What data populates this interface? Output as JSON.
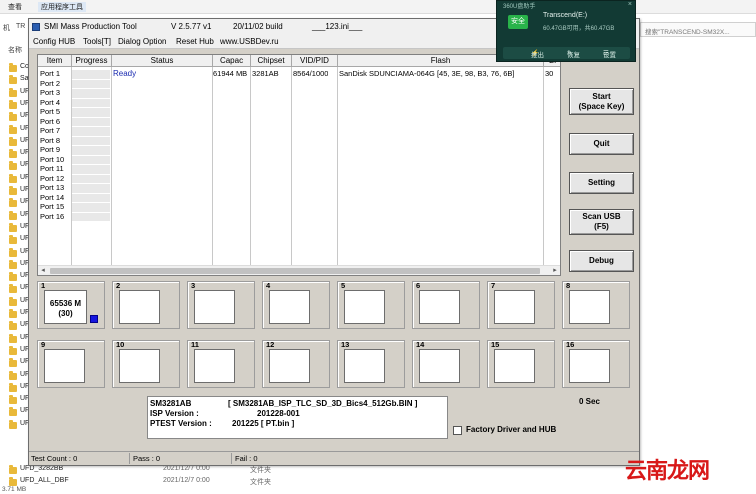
{
  "explorer": {
    "menu_view": "查看",
    "menu_app_tools": "应用程序工具",
    "addr_prefix": "机",
    "addr_tr": "TR",
    "search_placeholder": "搜索\"TRANSCEND-SM32X...",
    "col_name": "名称",
    "left_items": [
      "Co",
      "Sa",
      "UF",
      "UF",
      "UF",
      "UF",
      "UF",
      "UF",
      "UF",
      "UF",
      "UF",
      "UF",
      "UF",
      "UF",
      "UF",
      "UF",
      "UF",
      "UF",
      "UF",
      "UF",
      "UF",
      "UF",
      "UF",
      "UF",
      "UF",
      "UF",
      "UF",
      "UF",
      "UF",
      "UF"
    ],
    "bottom_rows": [
      {
        "name": "UFD_3282BB",
        "date": "2021/12/7 0:00",
        "type": "文件夹"
      },
      {
        "name": "UFD_ALL_DBF",
        "date": "2021/12/7 0:00",
        "type": "文件夹"
      }
    ],
    "status": "3.71 MB"
  },
  "app": {
    "title": "SMI Mass Production Tool",
    "version": "V 2.5.77   v1",
    "build": "20/11/02 build",
    "ini": "___123.ini___",
    "menu": [
      "Config HUB",
      "Tools[T]",
      "Dialog Option",
      "Reset Hub",
      "www.USBDev.ru"
    ],
    "grid_headers": [
      "Item",
      "Progress",
      "Status",
      "Capac",
      "Chipset",
      "VID/PID",
      "Flash",
      "Bi"
    ],
    "ports": [
      "Port 1",
      "Port 2",
      "Port 3",
      "Port 4",
      "Port 5",
      "Port 6",
      "Port 7",
      "Port 8",
      "Port 9",
      "Port 10",
      "Port 11",
      "Port 12",
      "Port 13",
      "Port 14",
      "Port 15",
      "Port 16"
    ],
    "row1": {
      "status": "Ready",
      "capacity": "61944 MB",
      "chipset": "3281AB",
      "vidpid": "8564/1000",
      "flash": "SanDisk SDUNCIAMA-064G [45, 3E, 98, B3, 76, 6B]",
      "extra": "30"
    },
    "buttons": {
      "start_line1": "Start",
      "start_line2": "(Space Key)",
      "quit": "Quit",
      "setting": "Setting",
      "scan_line1": "Scan USB",
      "scan_line2": "(F5)",
      "debug": "Debug"
    },
    "panel_numbers": [
      "1",
      "2",
      "3",
      "4",
      "5",
      "6",
      "7",
      "8",
      "9",
      "10",
      "11",
      "12",
      "13",
      "14",
      "15",
      "16"
    ],
    "panel1_capacity": "65536 M",
    "panel1_count": "(30)",
    "info": {
      "chip": "SM3281AB",
      "chip_file": "[ SM3281AB_ISP_TLC_SD_3D_Bics4_512Gb.BIN ]",
      "isp_label": "ISP Version :",
      "isp_value": "201228-001",
      "ptest_label": "PTEST Version :",
      "ptest_value": "201225 [ PT.bin ]"
    },
    "timer": "0 Sec",
    "factory_label": "Factory Driver and HUB",
    "status": {
      "test_count": "Test Count : 0",
      "pass": "Pass : 0",
      "fail": "Fail : 0"
    }
  },
  "overlay": {
    "title": "360U盘助手",
    "close": "×",
    "badge": "安全",
    "drive_name": "Transcend(E:)",
    "drive_space": "60.47GB可用，共60.47GB",
    "btn_eject": "推出",
    "btn_restore": "恢复",
    "btn_settings": "设置"
  },
  "watermark": "云南龙网",
  "colors": {
    "port_indicator": "#1515e0",
    "overlay_bg": "#123a34",
    "watermark": "#d81818"
  }
}
